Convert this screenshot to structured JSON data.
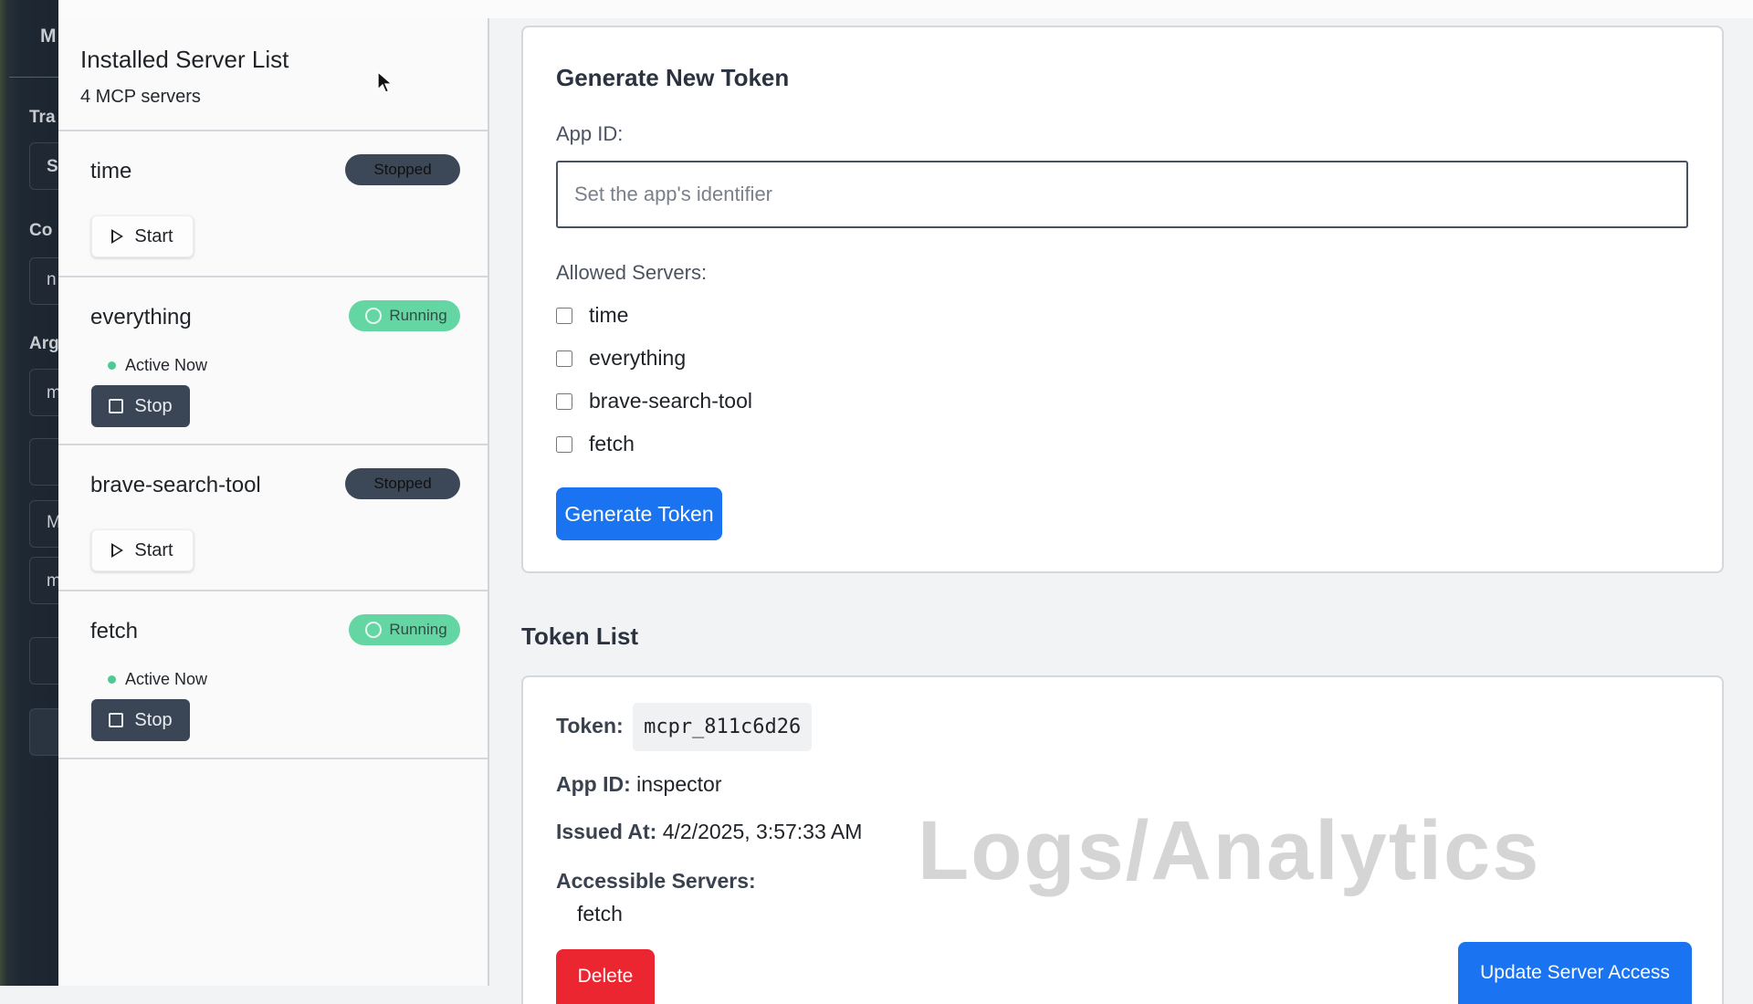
{
  "left_panel_fragments": [
    "M",
    "Tra",
    "S",
    "Co",
    "n",
    "Arg",
    "m",
    "M",
    "m"
  ],
  "sidebar": {
    "title": "Installed Server List",
    "count": "4 MCP servers",
    "servers": [
      {
        "name": "time",
        "status": "Stopped",
        "action": "Start"
      },
      {
        "name": "everything",
        "status": "Running",
        "activity": "Active Now",
        "action": "Stop"
      },
      {
        "name": "brave-search-tool",
        "status": "Stopped",
        "action": "Start"
      },
      {
        "name": "fetch",
        "status": "Running",
        "activity": "Active Now",
        "action": "Stop"
      }
    ]
  },
  "generate": {
    "title": "Generate New Token",
    "app_id_label": "App ID:",
    "app_id_placeholder": "Set the app's identifier",
    "app_id_value": "",
    "allowed_label": "Allowed Servers:",
    "allowed_servers": [
      {
        "name": "time",
        "checked": false
      },
      {
        "name": "everything",
        "checked": false
      },
      {
        "name": "brave-search-tool",
        "checked": false
      },
      {
        "name": "fetch",
        "checked": false
      }
    ],
    "button": "Generate Token"
  },
  "token_list": {
    "title": "Token List",
    "tokens": [
      {
        "token_label": "Token:",
        "token_value": "mcpr_811c6d26",
        "app_id_label": "App ID:",
        "app_id_value": "inspector",
        "issued_label": "Issued At:",
        "issued_value": "4/2/2025, 3:57:33 AM",
        "servers_label": "Accessible Servers:",
        "servers": [
          "fetch"
        ],
        "delete_label": "Delete",
        "update_label": "Update Server Access"
      }
    ]
  },
  "watermark": "Logs/Analytics",
  "colors": {
    "primary": "#1a73f0",
    "danger": "#eb2630",
    "running_badge": "#64d6a3",
    "stopped_badge": "#3c4757",
    "stop_button": "#3a4656"
  }
}
